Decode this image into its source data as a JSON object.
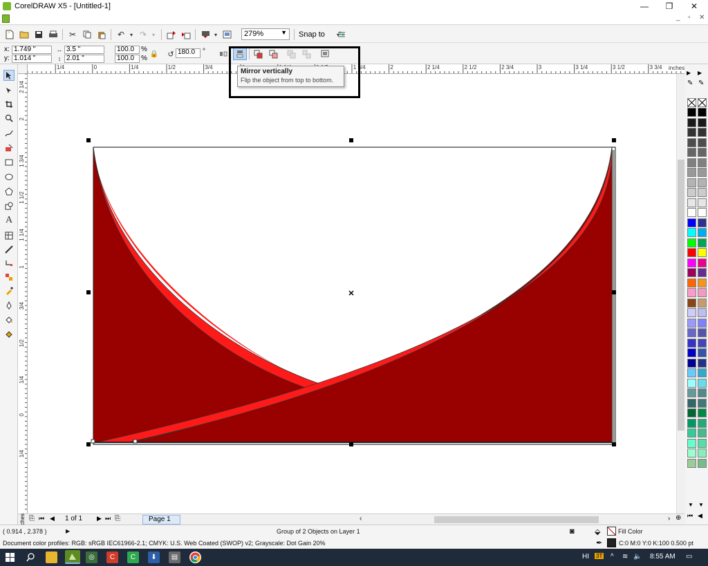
{
  "window": {
    "title": "CorelDRAW X5 - [Untitled-1]",
    "min_glyph": "—",
    "restore_glyph": "❐",
    "close_glyph": "✕"
  },
  "mdi": {
    "min": "_",
    "restore": "▫",
    "close": "✕"
  },
  "toolbar": {
    "zoom_value": "279%",
    "snap_label": "Snap to"
  },
  "property_bar": {
    "x_label": "x:",
    "x_value": "1.749 \"",
    "y_label": "y:",
    "y_value": "1.014 \"",
    "width_value": "3.5 \"",
    "height_value": "2.01 \"",
    "scale_x": "100.0",
    "scale_y": "100.0",
    "pct_x": "%",
    "pct_y": "%",
    "angle": "180.0",
    "degree": "°"
  },
  "tooltip": {
    "title": "Mirror vertically",
    "description": "Flip the object from top to bottom."
  },
  "hruler": {
    "labels": [
      "1/4",
      "0",
      "1/4",
      "1/2",
      "3/4",
      "1",
      "1 1/4",
      "1 1/2",
      "1 3/4",
      "2",
      "2 1/4",
      "2 1/2",
      "2 3/4",
      "3",
      "3 1/4",
      "3 1/2",
      "3 3/4"
    ],
    "unit": "inches"
  },
  "vruler": {
    "labels": [
      "2 1/4",
      "2",
      "1 3/4",
      "1 1/2",
      "1 1/4",
      "1",
      "3/4",
      "1/2",
      "1/4",
      "0",
      "1/4"
    ],
    "unit": "inches"
  },
  "page_nav": {
    "page_count": "1 of 1",
    "page_tab": "Page 1"
  },
  "status": {
    "coords": "( 0.914 , 2.378 )",
    "selection": "Group of 2 Objects on Layer 1",
    "color_profiles": "Document color profiles: RGB: sRGB IEC61966-2.1; CMYK: U.S. Web Coated (SWOP) v2; Grayscale: Dot Gain 20%",
    "fill_label": "Fill Color",
    "outline_label": "C:0 M:0 Y:0 K:100  0.500 pt"
  },
  "taskbar": {
    "lang": "HI",
    "time": "8:55 AM"
  },
  "colors": {
    "dark_red": "#990000",
    "bright_red": "#ff1a1a",
    "accent_highlight": "#000000"
  },
  "palette": [
    [
      "#000000",
      "#000000"
    ],
    [
      "#1a1a1a",
      "#1a1a1a"
    ],
    [
      "#333333",
      "#333333"
    ],
    [
      "#4d4d4d",
      "#4d4d4d"
    ],
    [
      "#666666",
      "#666666"
    ],
    [
      "#808080",
      "#808080"
    ],
    [
      "#999999",
      "#999999"
    ],
    [
      "#b3b3b3",
      "#b3b3b3"
    ],
    [
      "#cccccc",
      "#cccccc"
    ],
    [
      "#e6e6e6",
      "#e6e6e6"
    ],
    [
      "#ffffff",
      "#ffffff"
    ],
    [
      "#0000ff",
      "#2e3192"
    ],
    [
      "#00ffff",
      "#00aeef"
    ],
    [
      "#00ff00",
      "#00a651"
    ],
    [
      "#ff0000",
      "#ffff00"
    ],
    [
      "#ff00ff",
      "#ec008c"
    ],
    [
      "#9e005d",
      "#662d91"
    ],
    [
      "#ff6600",
      "#f7941d"
    ],
    [
      "#ff99cc",
      "#f49ac1"
    ],
    [
      "#8b4513",
      "#c69c6d"
    ],
    [
      "#ccccff",
      "#bdbdf0"
    ],
    [
      "#9999ff",
      "#8080ff"
    ],
    [
      "#6666cc",
      "#5555aa"
    ],
    [
      "#3333cc",
      "#4444bb"
    ],
    [
      "#0000cc",
      "#3355aa"
    ],
    [
      "#000099",
      "#223388"
    ],
    [
      "#66ccff",
      "#33aacc"
    ],
    [
      "#99ffff",
      "#66ddee"
    ],
    [
      "#669999",
      "#558888"
    ],
    [
      "#336666",
      "#447777"
    ],
    [
      "#006633",
      "#008844"
    ],
    [
      "#009966",
      "#22aa77"
    ],
    [
      "#33cc99",
      "#44bb88"
    ],
    [
      "#66ffcc",
      "#55ddaa"
    ],
    [
      "#99ffcc",
      "#88eebb"
    ],
    [
      "#99cc99",
      "#77bb88"
    ]
  ]
}
